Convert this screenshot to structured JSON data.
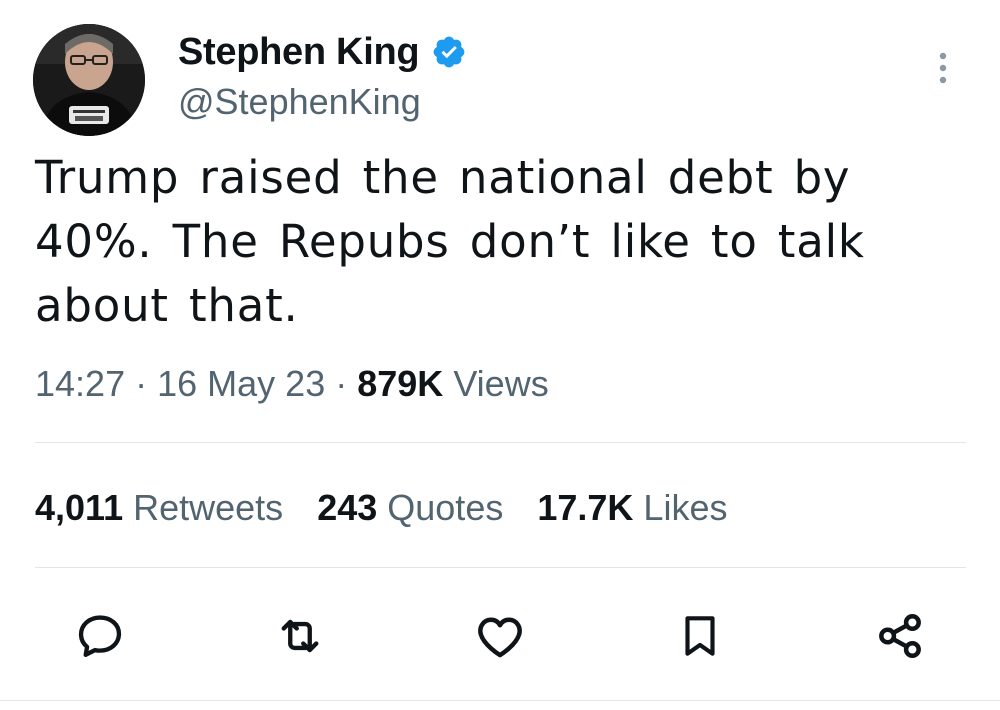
{
  "tweet": {
    "author": {
      "name": "Stephen King",
      "handle": "@StephenKing",
      "verified": true,
      "avatar": "avatar-photo"
    },
    "text": "Trump raised the national debt by 40%. The Repubs don’t like to talk about that.",
    "meta": {
      "time": "14:27",
      "separator": "·",
      "date": "16 May 23",
      "views_count": "879K",
      "views_label": "Views"
    },
    "stats": [
      {
        "count": "4,011",
        "label": "Retweets"
      },
      {
        "count": "243",
        "label": "Quotes"
      },
      {
        "count": "17.7K",
        "label": "Likes"
      }
    ],
    "actions": [
      {
        "name": "reply",
        "icon": "speech-bubble-icon"
      },
      {
        "name": "retweet",
        "icon": "retweet-icon"
      },
      {
        "name": "like",
        "icon": "heart-icon"
      },
      {
        "name": "bookmark",
        "icon": "bookmark-icon"
      },
      {
        "name": "share",
        "icon": "share-icon"
      }
    ]
  },
  "colors": {
    "text": "#0f1419",
    "secondary": "#536471",
    "verified": "#1d9bf0",
    "divider": "#e1e6ea"
  }
}
